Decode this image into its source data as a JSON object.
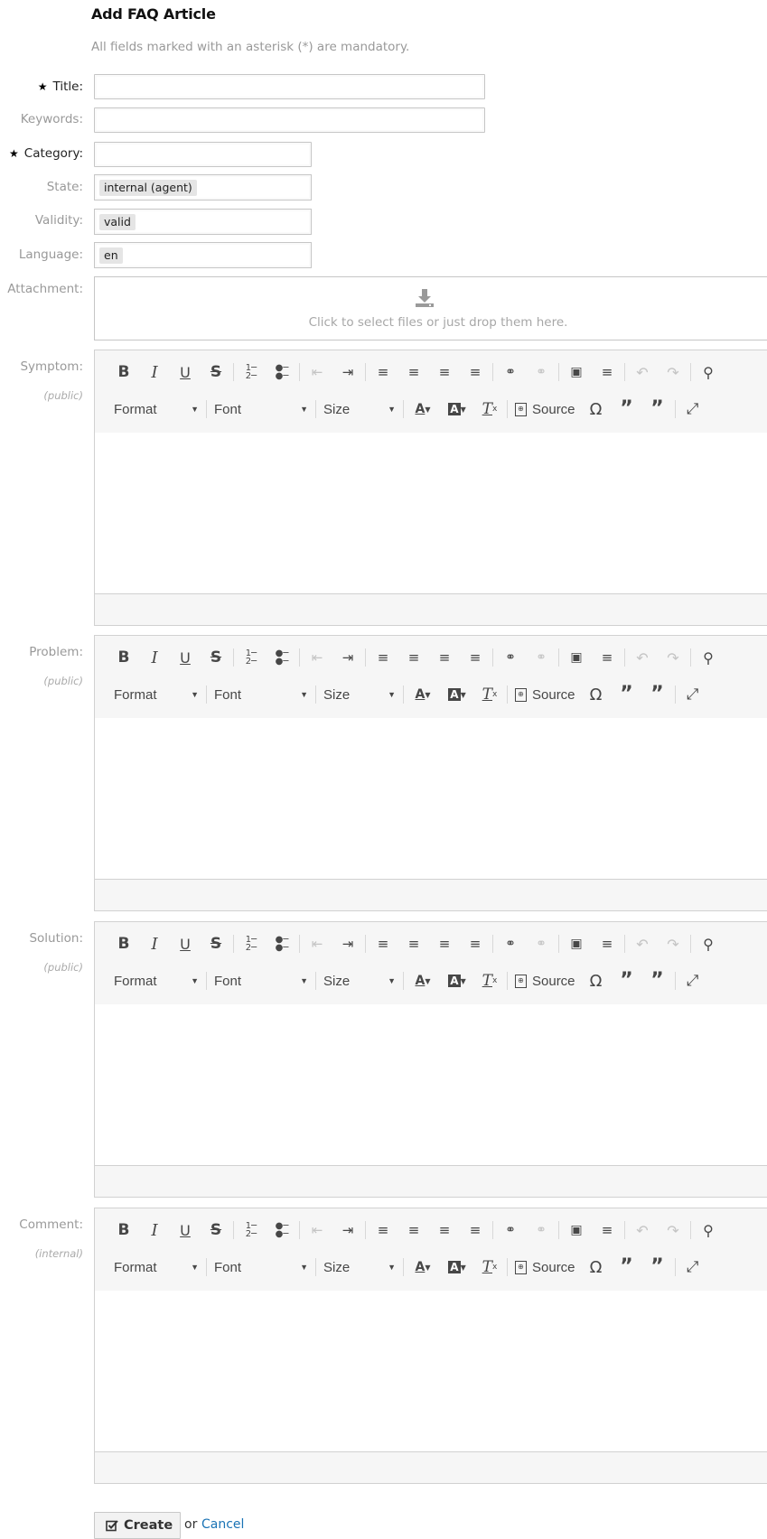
{
  "page": {
    "title": "Add FAQ Article",
    "mandatory_note": "All fields marked with an asterisk (*) are mandatory."
  },
  "fields": {
    "title": {
      "label": "Title:",
      "required": true,
      "value": ""
    },
    "keywords": {
      "label": "Keywords:",
      "value": ""
    },
    "category": {
      "label": "Category:",
      "required": true,
      "value": ""
    },
    "state": {
      "label": "State:",
      "value": "internal (agent)"
    },
    "validity": {
      "label": "Validity:",
      "value": "valid"
    },
    "language": {
      "label": "Language:",
      "value": "en"
    },
    "attachment": {
      "label": "Attachment:",
      "drop_text": "Click to select files or just drop them here.",
      "icon": "upload-icon"
    }
  },
  "editors": [
    {
      "label": "Symptom:",
      "visibility": "(public)"
    },
    {
      "label": "Problem:",
      "visibility": "(public)"
    },
    {
      "label": "Solution:",
      "visibility": "(public)"
    },
    {
      "label": "Comment:",
      "visibility": "(internal)"
    }
  ],
  "toolbar": {
    "format_label": "Format",
    "font_label": "Font",
    "size_label": "Size",
    "source_label": "Source",
    "icons_row1": [
      "bold-icon",
      "italic-icon",
      "underline-icon",
      "strikethrough-icon",
      "numbered-list-icon",
      "bulleted-list-icon",
      "outdent-icon",
      "indent-icon",
      "align-left-icon",
      "align-center-icon",
      "align-right-icon",
      "justify-icon",
      "link-icon",
      "unlink-icon",
      "image-icon",
      "horizontal-line-icon",
      "undo-icon",
      "redo-icon",
      "find-icon"
    ],
    "icons_row2": [
      "text-color-icon",
      "background-color-icon",
      "remove-format-icon",
      "source-icon",
      "special-character-icon",
      "blockquote-icon",
      "remove-quote-icon",
      "maximize-icon"
    ]
  },
  "actions": {
    "create_label": "Create",
    "or_text": "or",
    "cancel_label": "Cancel"
  },
  "colors": {
    "link": "#1a73b5",
    "label_muted": "#999999",
    "toolbar_bg": "#f6f6f6"
  }
}
